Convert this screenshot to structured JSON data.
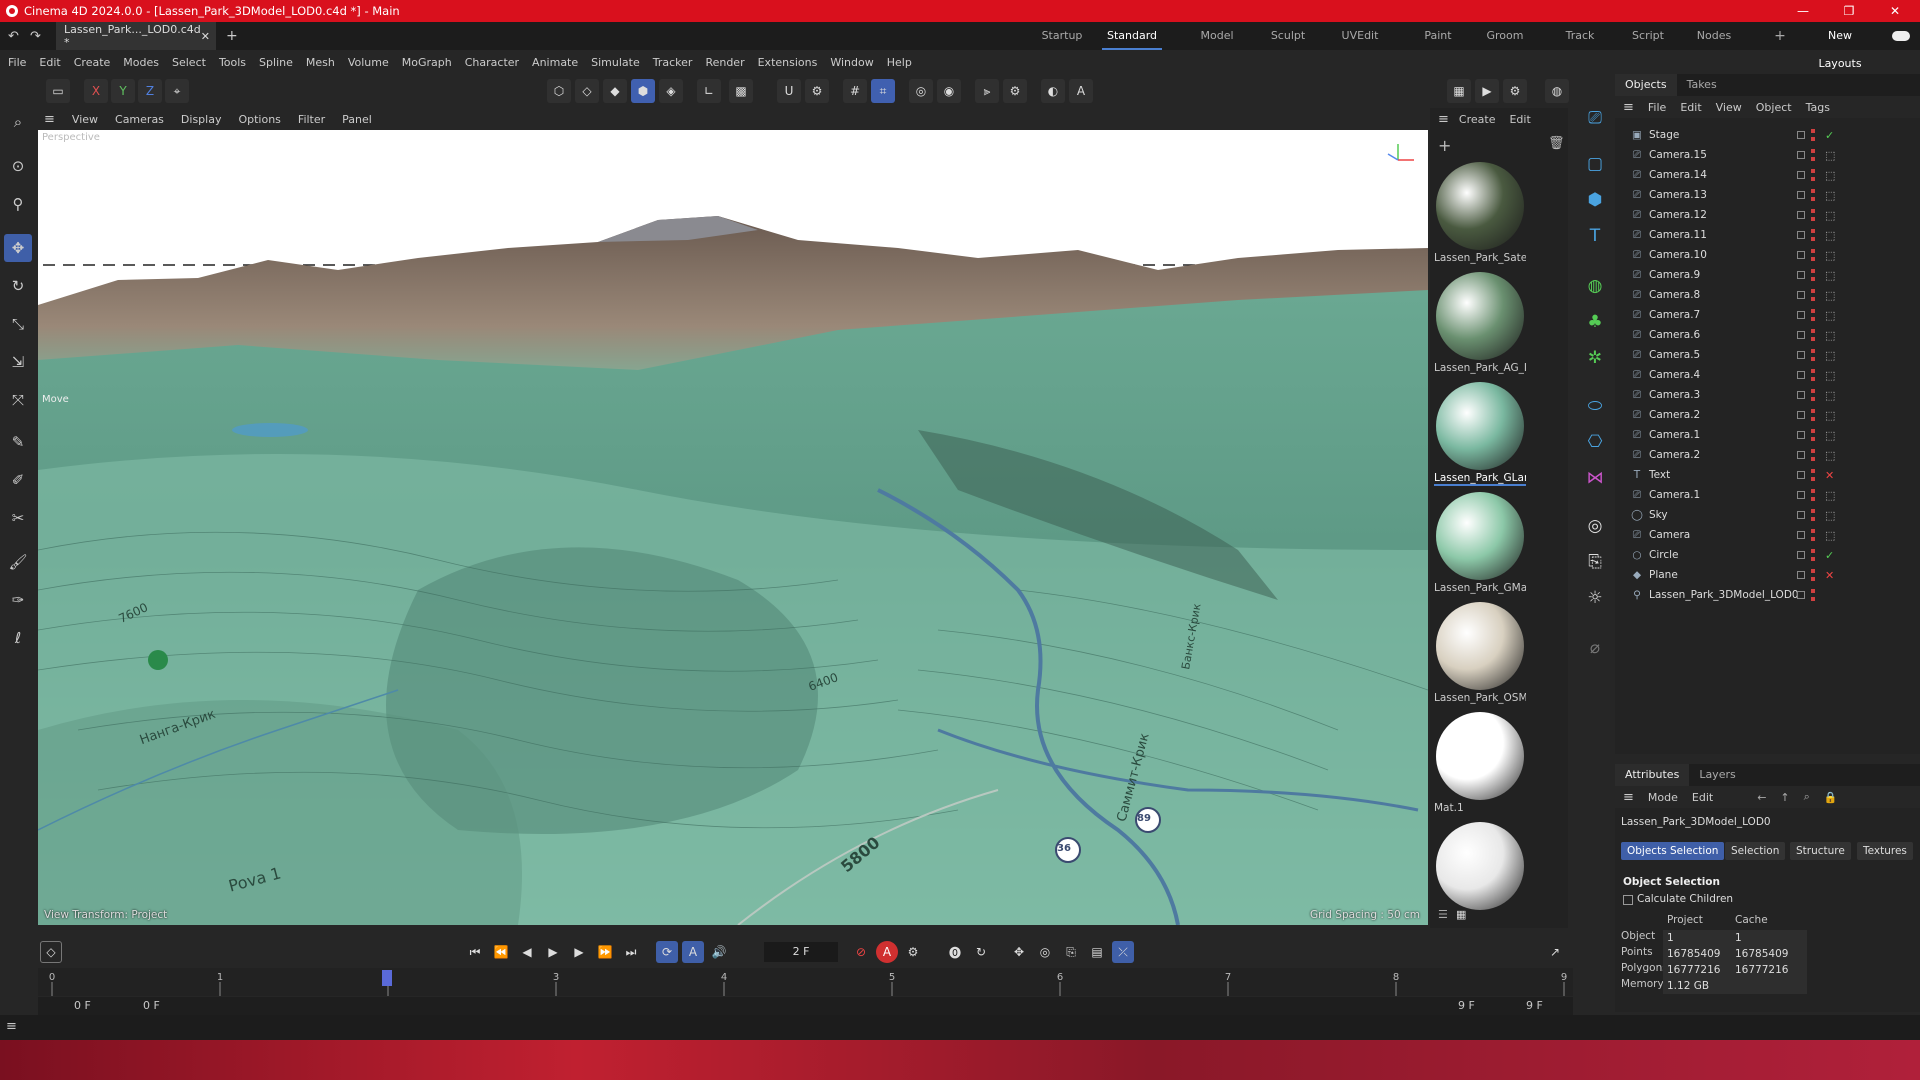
{
  "window": {
    "title": "Cinema 4D 2024.0.0 - [Lassen_Park_3DModel_LOD0.c4d *] - Main"
  },
  "doc_tab": {
    "label": "Lassen_Park..._LOD0.c4d *",
    "close": "✕",
    "add": "+"
  },
  "layouts": {
    "items": [
      "Startup",
      "Standard",
      "Model",
      "Sculpt",
      "UVEdit",
      "Paint",
      "Groom",
      "Track",
      "Script",
      "Nodes"
    ],
    "active": "Standard",
    "new_layouts": "New Layouts"
  },
  "menu": [
    "File",
    "Edit",
    "Create",
    "Modes",
    "Select",
    "Tools",
    "Spline",
    "Mesh",
    "Volume",
    "MoGraph",
    "Character",
    "Animate",
    "Simulate",
    "Tracker",
    "Render",
    "Extensions",
    "Window",
    "Help"
  ],
  "axis_buttons": [
    "X",
    "Y",
    "Z"
  ],
  "viewport_menu": [
    "View",
    "Cameras",
    "Display",
    "Options",
    "Filter",
    "Panel"
  ],
  "viewport": {
    "camera_label": "Perspective",
    "view_transform": "View Transform: Project",
    "grid_spacing": "Grid Spacing : 50 cm",
    "move_label": "Move",
    "map_labels": [
      "5800",
      "6400",
      "7600",
      "Pova 1",
      "Саммит-Крик",
      "Банкс-Крик",
      "Нанга-Крик",
      "36",
      "89"
    ]
  },
  "material_menu": [
    "Create",
    "Edit"
  ],
  "materials": [
    {
      "name": "Lassen_Park_Satel",
      "color": "#4a5a40"
    },
    {
      "name": "Lassen_Park_AG_L",
      "color": "#6a9070"
    },
    {
      "name": "Lassen_Park_GLan",
      "color": "#7ab8a0"
    },
    {
      "name": "Lassen_Park_GMa",
      "color": "#8cc8a8"
    },
    {
      "name": "Lassen_Park_OSM",
      "color": "#d8d0c0"
    },
    {
      "name": "Mat.1",
      "color": "#ffffff"
    },
    {
      "name": "",
      "color": "#e8e8e8"
    }
  ],
  "objects_panel": {
    "tabs": [
      "Objects",
      "Takes"
    ],
    "menu": [
      "File",
      "Edit",
      "View",
      "Object",
      "Tags"
    ],
    "rows": [
      "Stage",
      "Camera.15",
      "Camera.14",
      "Camera.13",
      "Camera.12",
      "Camera.11",
      "Camera.10",
      "Camera.9",
      "Camera.8",
      "Camera.7",
      "Camera.6",
      "Camera.5",
      "Camera.4",
      "Camera.3",
      "Camera.2",
      "Camera.1",
      "Camera.2",
      "Text",
      "Camera.1",
      "Sky",
      "Camera",
      "Circle",
      "Plane",
      "Lassen_Park_3DModel_LOD0"
    ]
  },
  "attributes": {
    "tabs": [
      "Attributes",
      "Layers"
    ],
    "menu": [
      "Mode",
      "Edit"
    ],
    "object_name": "Lassen_Park_3DModel_LOD0",
    "subtabs": [
      "Objects Selection",
      "Selection",
      "Structure",
      "Textures"
    ],
    "section": "Object Selection",
    "calc_children": "Calculate Children",
    "col_project": "Project",
    "col_cache": "Cache",
    "rows": [
      {
        "label": "Object",
        "project": "1",
        "cache": "1"
      },
      {
        "label": "Points",
        "project": "16785409",
        "cache": "16785409"
      },
      {
        "label": "Polygons",
        "project": "16777216",
        "cache": "16777216"
      },
      {
        "label": "Memory",
        "project": "1.12 GB",
        "cache": ""
      }
    ]
  },
  "timeline": {
    "current_frame": "2 F",
    "start": "0 F",
    "start2": "0 F",
    "end": "9 F",
    "end2": "9 F",
    "ticks": [
      "0",
      "1",
      "2",
      "3",
      "4",
      "5",
      "6",
      "7",
      "8",
      "9"
    ],
    "playhead": 2
  }
}
